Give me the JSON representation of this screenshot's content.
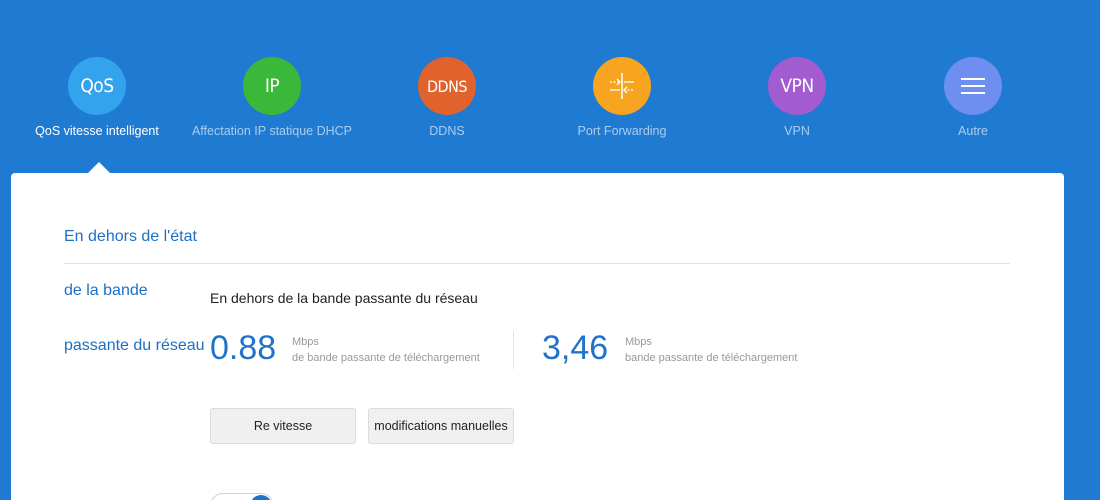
{
  "nav": {
    "items": [
      {
        "icon_text": "QoS",
        "label": "QoS vitesse intelligent",
        "color": "#33a3ee",
        "active": true
      },
      {
        "icon_text": "IP",
        "label": "Affectation IP statique DHCP",
        "color": "#39b83a",
        "active": false
      },
      {
        "icon_text": "DDNS",
        "label": "DDNS",
        "color": "#e0632e",
        "active": false
      },
      {
        "icon_text": "",
        "icon": "port-forwarding-icon",
        "label": "Port Forwarding",
        "color": "#f7a421",
        "active": false
      },
      {
        "icon_text": "VPN",
        "label": "VPN",
        "color": "#a35bd0",
        "active": false
      },
      {
        "icon_text": "",
        "icon": "menu-icon",
        "label": "Autre",
        "color": "#6e8ef0",
        "active": false
      }
    ]
  },
  "panel": {
    "side_title": [
      "En dehors de l'état",
      "de la bande",
      "passante du réseau"
    ],
    "section_title": "En dehors de la bande passante du réseau",
    "download": {
      "value": "0.88",
      "unit": "Mbps",
      "desc": "de bande passante de téléchargement"
    },
    "upload": {
      "value": "3,46",
      "unit": "Mbps",
      "desc": "bande passante de téléchargement"
    },
    "buttons": {
      "retest": "Re vitesse",
      "manual": "modifications manuelles"
    },
    "toggle_on": true
  },
  "colors": {
    "background": "#1f7ad1",
    "accent": "#1f73c8"
  }
}
